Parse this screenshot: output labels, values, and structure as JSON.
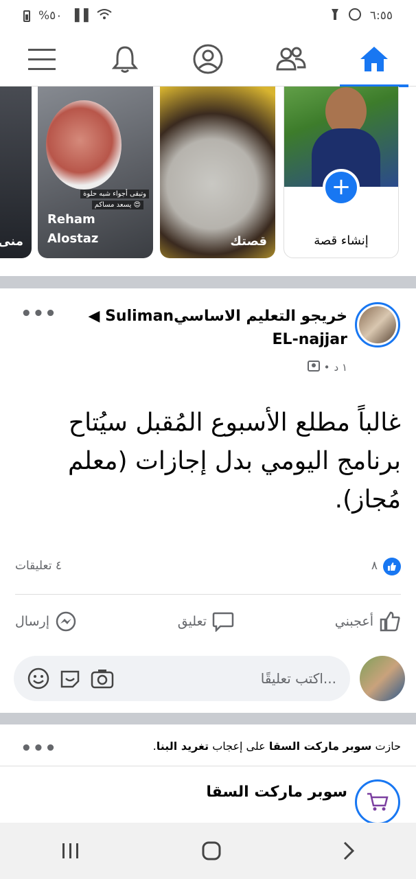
{
  "status_bar": {
    "time": "٦:٥٥",
    "battery": "%٥٠"
  },
  "nav": {
    "items": [
      "home-icon",
      "friends-icon",
      "profile-icon",
      "bell-icon",
      "menu-icon"
    ],
    "active_color": "#1877f2"
  },
  "stories": {
    "create_label": "إنشاء قصة",
    "items": [
      {
        "label": "قصتك"
      },
      {
        "label": "Reham\nAlostaz",
        "caption1": "وتبقى أجواء شبه حلوة",
        "caption2": "يسعد مساكم 😍"
      },
      {
        "label": "منى"
      }
    ]
  },
  "post": {
    "author_line1": "خريجو التعليم الاساسي",
    "author_name": "Suliman",
    "author_name2": "EL-najjar",
    "time": "١ د",
    "text": "غالباً مطلع الأسبوع المُقبل سيُتاح برنامج اليومي بدل إجازات (معلم مُجاز).",
    "likes": "٨",
    "comments": "٤ تعليقات",
    "actions": {
      "like": "أعجبني",
      "comment": "تعليق",
      "send": "إرسال"
    },
    "comment_placeholder": "اكتب تعليقًا..."
  },
  "post2": {
    "notice_prefix": "حازت",
    "notice_page": "سوبر ماركت السقا",
    "notice_mid": "على إعجاب",
    "notice_user": "تغريد البنا",
    "notice_suffix": ".",
    "page_name": "سوبر ماركت السقا"
  }
}
